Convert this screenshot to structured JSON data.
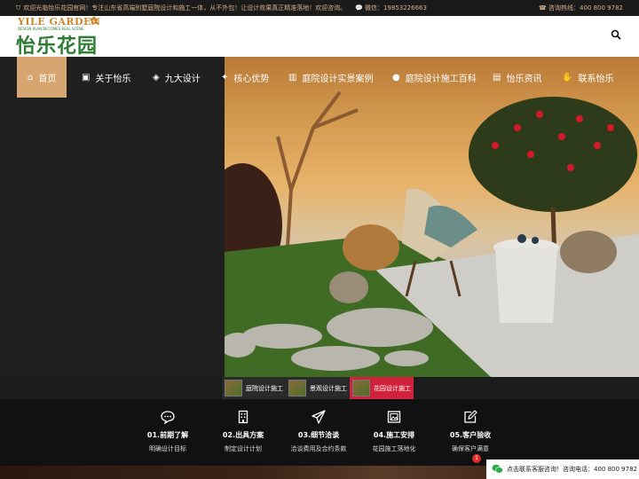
{
  "topbar": {
    "welcome": "欢迎光临怡乐花园官网！专注山东省高端别墅庭院设计和施工一体，从不外包！让设计效果真正精准落地！欢迎咨询。",
    "wechat": "微信：19853226663",
    "hotline": "咨询热线：400 800 9782"
  },
  "logo": {
    "en": "YILE GARDEN",
    "tagline": "DESIGN PLAN BECOMES REAL SCENE",
    "cn": "怡乐花园"
  },
  "nav": [
    {
      "label": "首页",
      "icon": "home-icon"
    },
    {
      "label": "关于怡乐",
      "icon": "id-card-icon"
    },
    {
      "label": "九大设计",
      "icon": "layers-icon"
    },
    {
      "label": "核心优势",
      "icon": "thumb-icon"
    },
    {
      "label": "庭院设计实景案例",
      "icon": "building-icon"
    },
    {
      "label": "庭院设计施工百科",
      "icon": "user-icon"
    },
    {
      "label": "怡乐资讯",
      "icon": "news-icon"
    },
    {
      "label": "联系怡乐",
      "icon": "handshake-icon"
    }
  ],
  "thumbs": [
    {
      "label": "庭院设计施工"
    },
    {
      "label": "景观设计施工"
    },
    {
      "label": "花园设计施工"
    }
  ],
  "steps": [
    {
      "title": "01.前期了解",
      "desc": "明确设计目标",
      "icon": "chat-bubble-icon"
    },
    {
      "title": "02.出具方案",
      "desc": "制定设计计划",
      "icon": "building-icon"
    },
    {
      "title": "03.细节洽谈",
      "desc": "洽谈费用及合约条款",
      "icon": "send-icon"
    },
    {
      "title": "04.施工安排",
      "desc": "花园施工落地化",
      "icon": "image-icon"
    },
    {
      "title": "05.客户验收",
      "desc": "确保客户满意",
      "icon": "edit-icon"
    }
  ],
  "chat": {
    "text": "点击联系客服咨询！咨询电话：400 800 9782",
    "badge": "1"
  },
  "colors": {
    "accent": "#d7a56f",
    "active_thumb": "#d2213a",
    "logo_green": "#2e7d32",
    "logo_gold": "#c8882f"
  }
}
